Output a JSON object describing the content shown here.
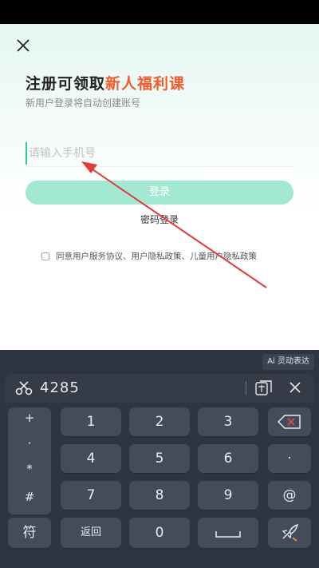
{
  "header": {
    "title_prefix": "注册可领取",
    "title_highlight": "新人福利课",
    "subtitle": "新用户登录将自动创建账号"
  },
  "form": {
    "phone_placeholder": "请输入手机号",
    "login_label": "登录",
    "password_login": "密码登录",
    "agreement": "同意用户服务协议、用户隐私政策、儿童用户隐私政策"
  },
  "colors": {
    "accent": "#2ec9a0",
    "highlight": "#f25a2a",
    "button": "#a2e8d2",
    "annotation": "#e03c3c"
  },
  "keyboard": {
    "ai_label": "Ai 灵动表达",
    "clipboard_text": "4285",
    "side_symbols": [
      "+",
      "·",
      "*",
      "#"
    ],
    "keys": {
      "k1": "1",
      "k2": "2",
      "k3": "3",
      "k4": "4",
      "k5": "5",
      "k6": "6",
      "k7": "7",
      "k8": "8",
      "k9": "9",
      "k0": "0",
      "dot": "·",
      "at": "@",
      "symbols": "符",
      "back": "返回"
    }
  }
}
